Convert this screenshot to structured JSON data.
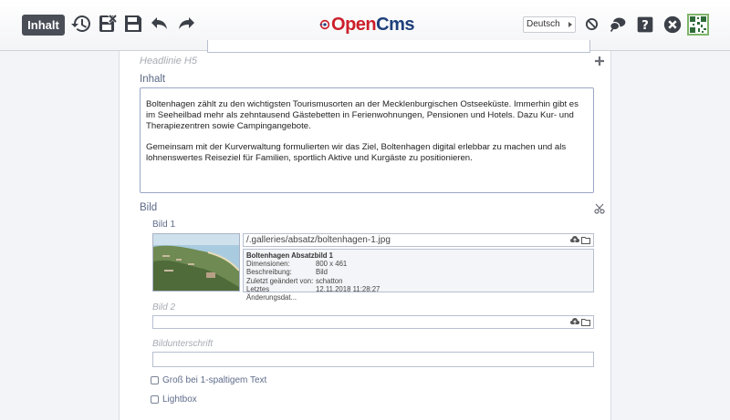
{
  "toolbar": {
    "mode_label": "Inhalt",
    "icons": [
      "history-icon",
      "discard-icon",
      "save-icon",
      "undo-icon",
      "redo-icon"
    ],
    "right_icons": [
      "prevent-icon",
      "chat-icon",
      "help-icon",
      "close-icon",
      "qr-code-icon"
    ],
    "logo": {
      "part1": "Open",
      "part2": "Cms"
    },
    "language": "Deutsch",
    "colors": {
      "mode_bg": "#4a4e57",
      "logo_red": "#cc1f2b",
      "logo_blue": "#1d3f7a"
    }
  },
  "form": {
    "headline_label": "Headlinie H5",
    "inhalt_label": "Inhalt",
    "paragraphs": [
      "Boltenhagen zählt zu den wichtigsten Tourismusorten an der Mecklenburgischen Ostseeküste. Immerhin gibt es im Seeheilbad mehr als zehntausend Gästebetten in Ferienwohnungen, Pensionen und Hotels. Dazu Kur- und Therapiezentren sowie Campingangebote.",
      "Gemeinsam mit der Kurverwaltung formulierten wir das Ziel, Boltenhagen digital erlebbar zu machen und als lohnenswertes Reiseziel für Familien, sportlich Aktive und Kurgäste zu positionieren."
    ],
    "bild_section_label": "Bild",
    "bild1": {
      "label": "Bild 1",
      "path": "/.galleries/absatz/boltenhagen-1.jpg",
      "info_title": "Boltenhagen Absatzbild 1",
      "info_rows": [
        {
          "key": "Dimensionen:",
          "value": "800 x 461"
        },
        {
          "key": "Beschreibung:",
          "value": "Bild"
        },
        {
          "key": "Zuletzt geändert von:",
          "value": "schatton"
        },
        {
          "key": "Letztes Änderungsdat...",
          "value": "12.11.2018 11:28:27"
        }
      ]
    },
    "bild2_label": "Bild 2",
    "caption_label": "Bildunterschrift",
    "checkbox_large": "Groß bei 1-spaltigem Text",
    "checkbox_lightbox": "Lightbox"
  }
}
